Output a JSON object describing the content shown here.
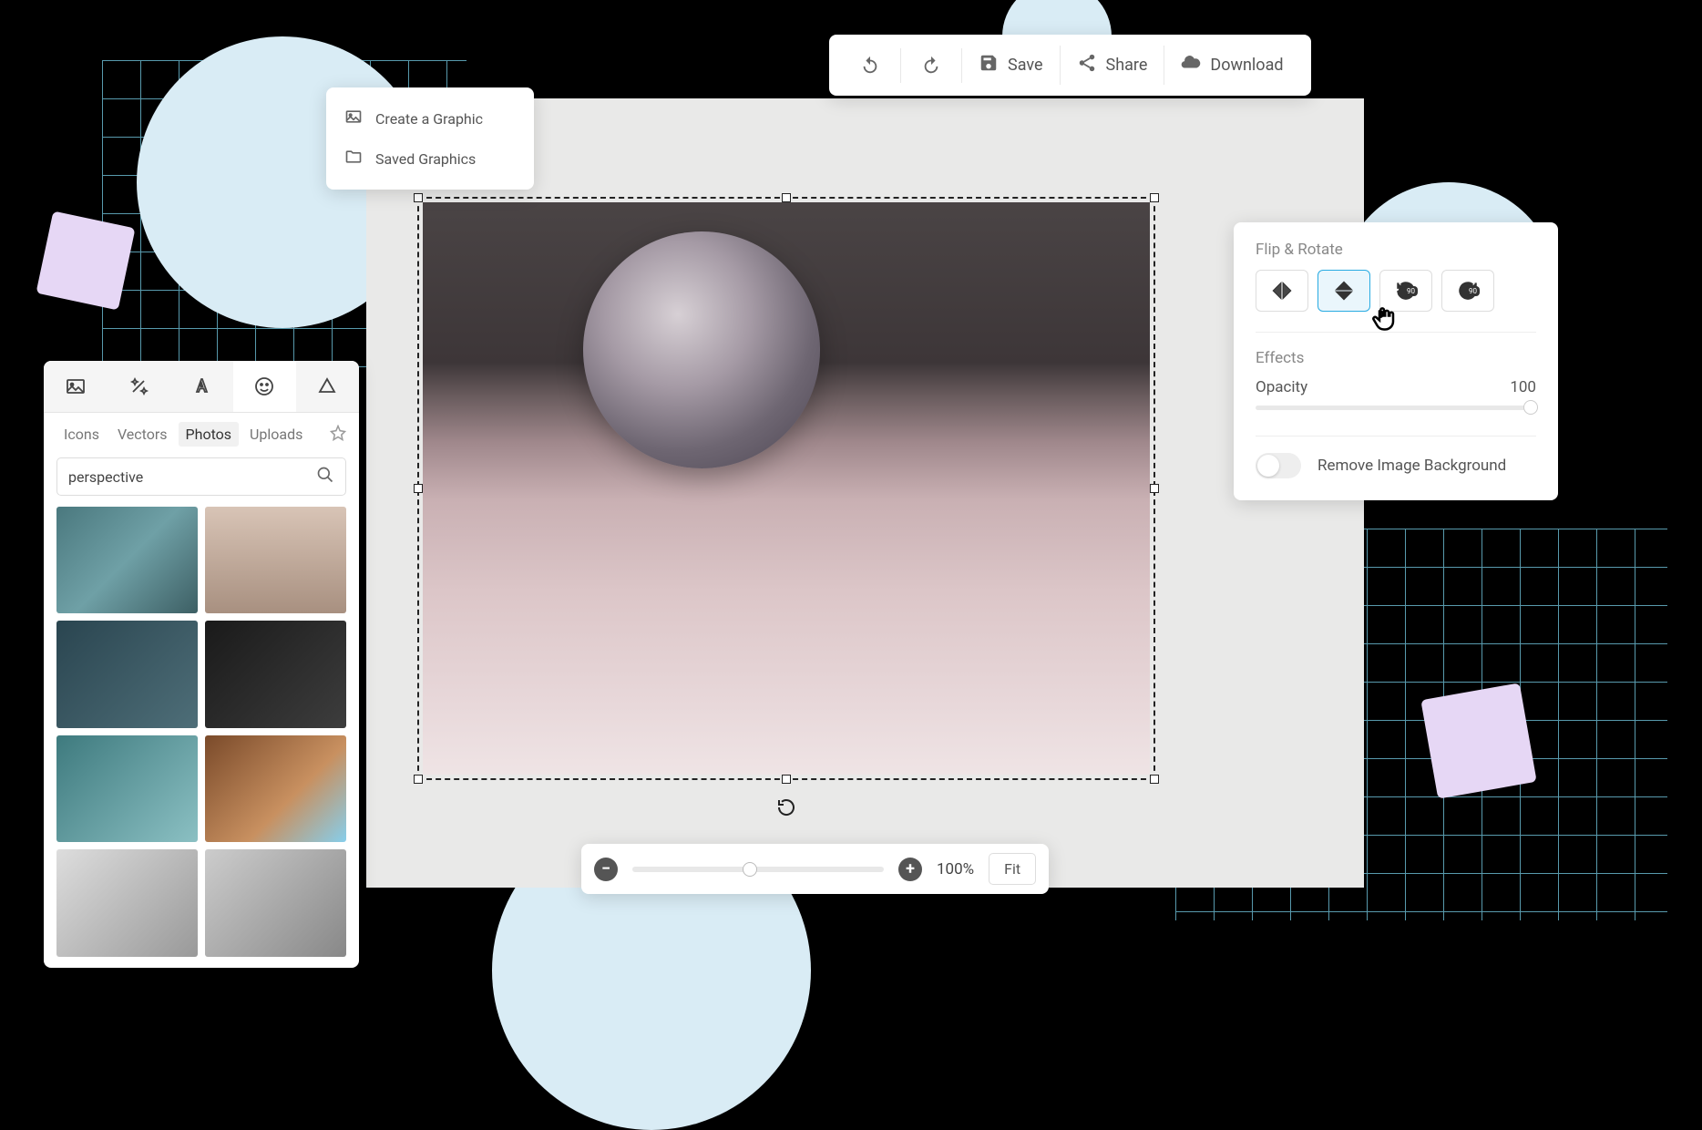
{
  "toolbar": {
    "save_label": "Save",
    "share_label": "Share",
    "download_label": "Download"
  },
  "graphic_menu": {
    "create_label": "Create a Graphic",
    "saved_label": "Saved Graphics"
  },
  "zoom": {
    "percent_label": "100%",
    "fit_label": "Fit"
  },
  "left_panel": {
    "sub_tabs": [
      "Icons",
      "Vectors",
      "Photos",
      "Uploads"
    ],
    "active_sub_tab": "Photos",
    "search_value": "perspective"
  },
  "effects": {
    "flip_rotate_label": "Flip & Rotate",
    "effects_label": "Effects",
    "opacity_label": "Opacity",
    "opacity_value": "100",
    "remove_bg_label": "Remove Image Background",
    "rotate_90_label": "90"
  }
}
